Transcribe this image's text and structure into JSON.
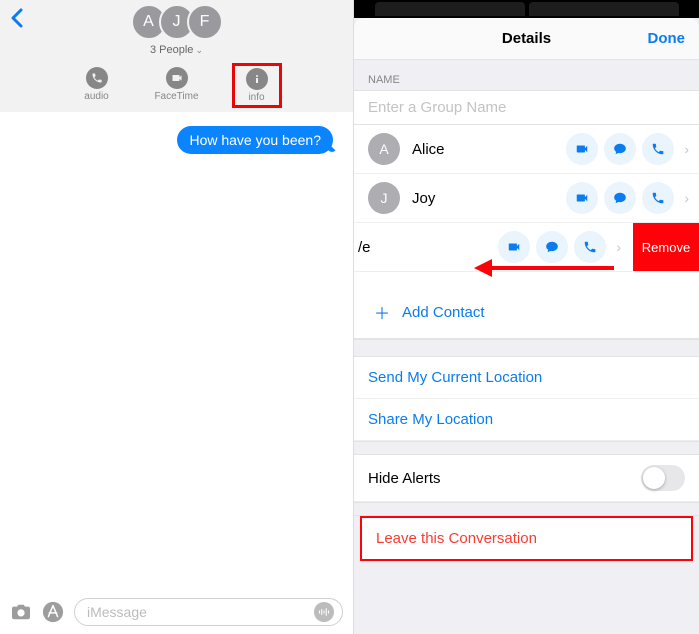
{
  "left": {
    "avatars": [
      "A",
      "J",
      "F"
    ],
    "people_count": "3 People",
    "actions": {
      "audio": "audio",
      "facetime": "FaceTime",
      "info": "info"
    },
    "message": "How have you been?",
    "input_placeholder": "iMessage"
  },
  "right": {
    "title": "Details",
    "done": "Done",
    "name_label": "NAME",
    "group_name_placeholder": "Enter a Group Name",
    "participants": [
      {
        "initial": "A",
        "name": "Alice"
      },
      {
        "initial": "J",
        "name": "Joy"
      },
      {
        "initial": "",
        "name": "/e",
        "swiped": true
      }
    ],
    "remove_label": "Remove",
    "add_contact": "Add Contact",
    "send_location": "Send My Current Location",
    "share_location": "Share My Location",
    "hide_alerts": "Hide Alerts",
    "leave": "Leave this Conversation"
  }
}
